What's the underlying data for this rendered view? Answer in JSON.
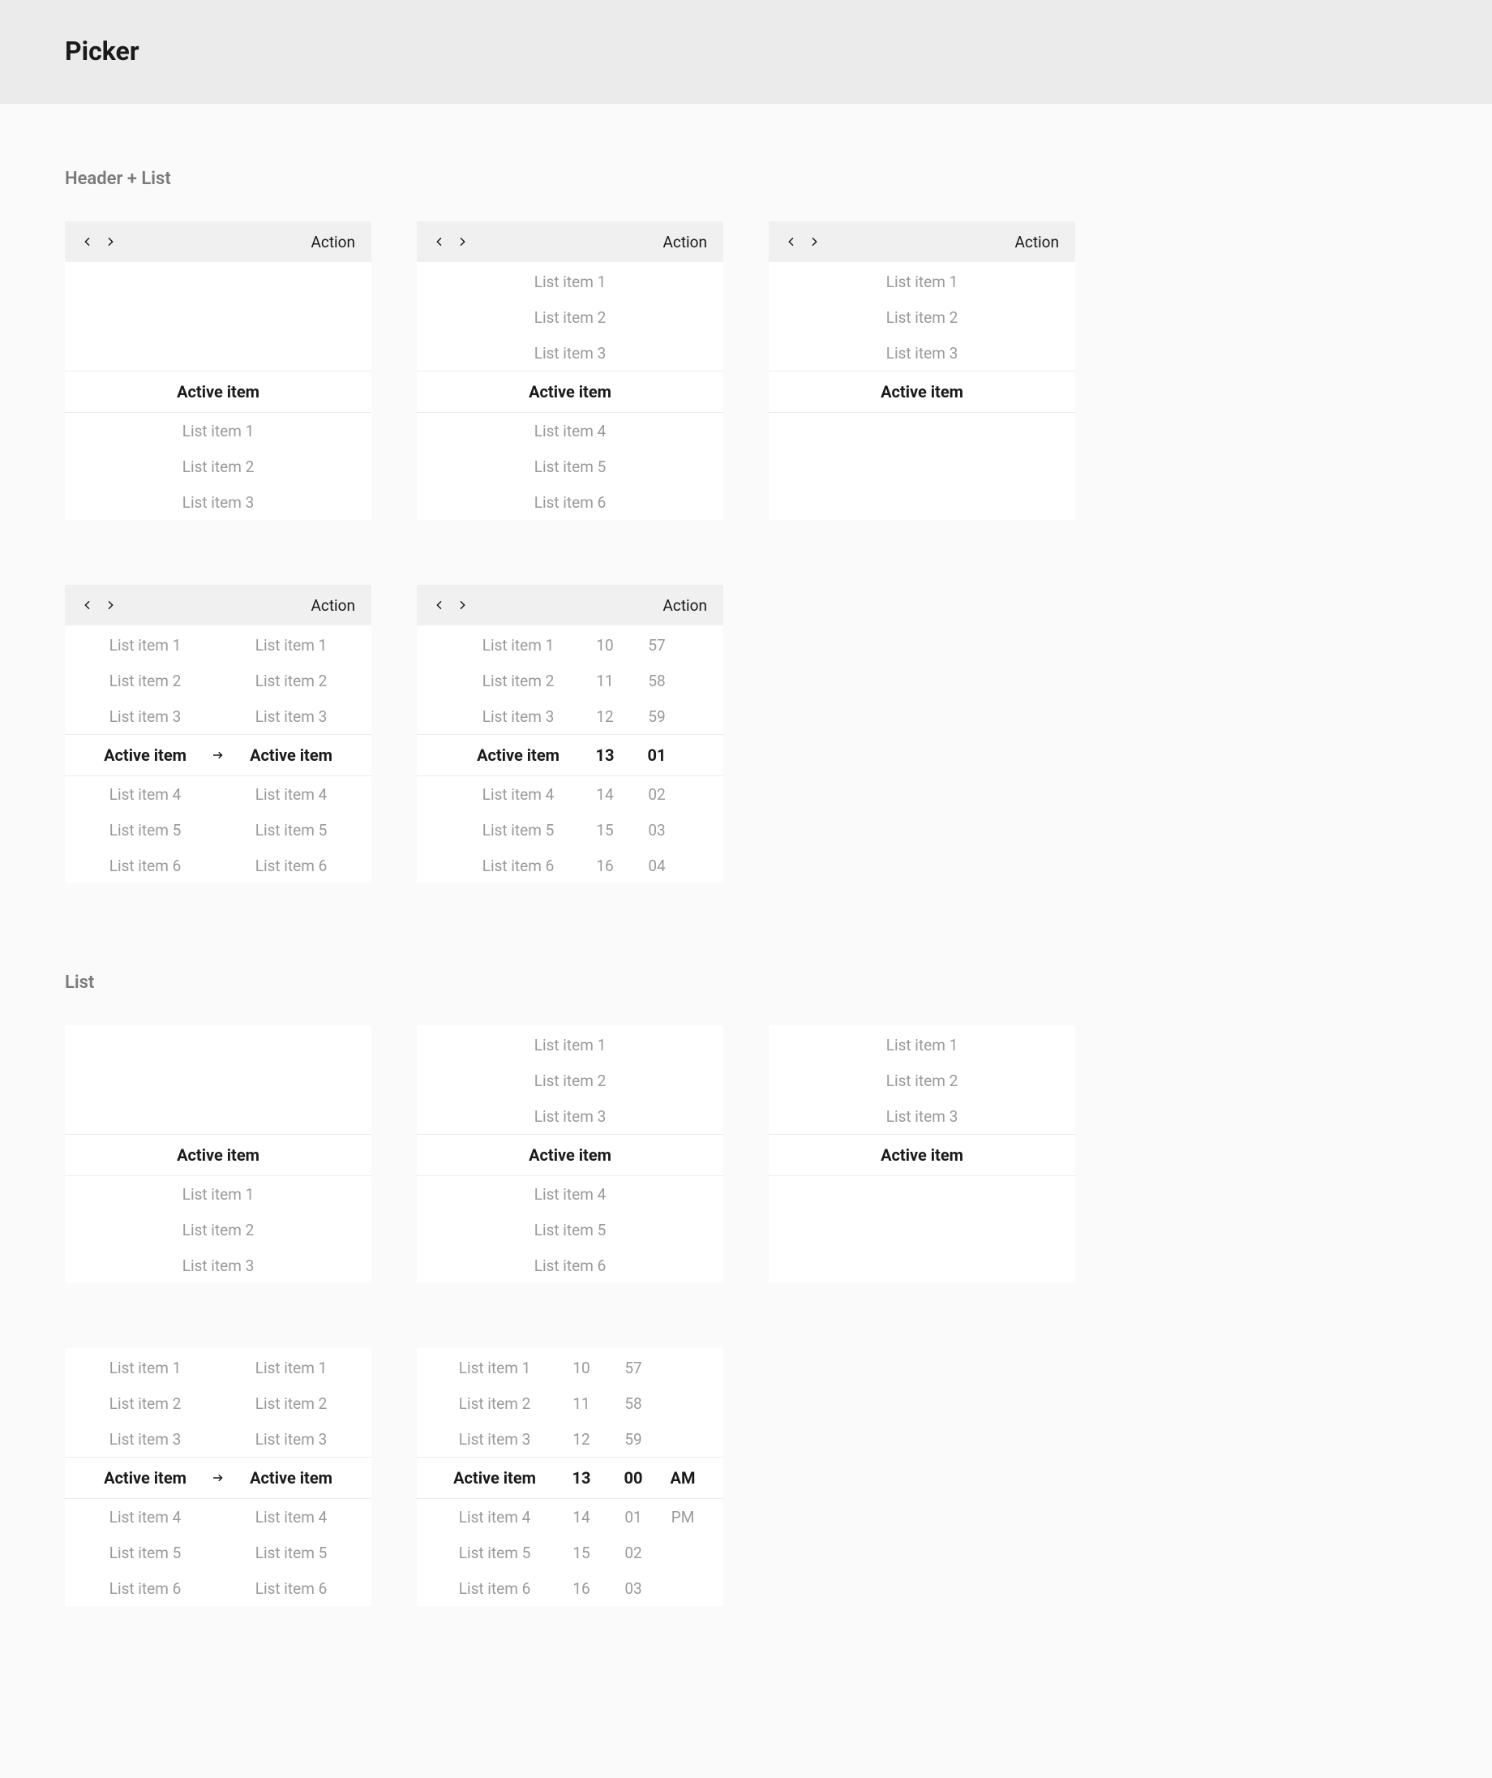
{
  "page": {
    "title": "Picker"
  },
  "sections": {
    "headerList": "Header + List",
    "list": "List"
  },
  "header": {
    "action": "Action"
  },
  "items": {
    "active": "Active item",
    "i1": "List item 1",
    "i2": "List item 2",
    "i3": "List item 3",
    "i4": "List item 4",
    "i5": "List item 5",
    "i6": "List item 6"
  },
  "numsA": {
    "r1": "10",
    "r2": "11",
    "r3": "12",
    "active": "13",
    "r5": "14",
    "r6": "15",
    "r7": "16"
  },
  "numsB": {
    "r1": "57",
    "r2": "58",
    "r3": "59",
    "active": "01",
    "r5": "02",
    "r6": "03",
    "r7": "04"
  },
  "numsB2": {
    "r1": "57",
    "r2": "58",
    "r3": "59",
    "active": "00",
    "r5": "01",
    "r6": "02",
    "r7": "03"
  },
  "ampm": {
    "active": "AM",
    "r5": "PM"
  }
}
